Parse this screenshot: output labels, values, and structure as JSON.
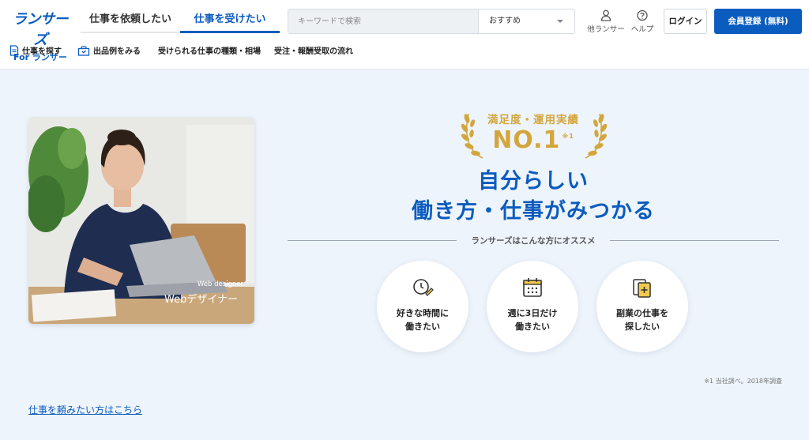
{
  "header": {
    "logo": {
      "main": "ランサーズ",
      "sub": "For ランサー"
    },
    "tabs": [
      {
        "label": "仕事を依頼したい",
        "active": false
      },
      {
        "label": "仕事を受けたい",
        "active": true
      }
    ],
    "search": {
      "placeholder": "キーワードで検索",
      "value": "",
      "sort_selected": "おすすめ"
    },
    "icons": {
      "other_lancers": {
        "label": "他ランサー",
        "icon": "person-icon"
      },
      "help": {
        "label": "ヘルプ",
        "icon": "question-circle-icon"
      }
    },
    "login_label": "ログイン",
    "register_label": "会員登録 (無料)"
  },
  "subnav": [
    {
      "label": "仕事を探す",
      "icon": "document-icon"
    },
    {
      "label": "出品例をみる",
      "icon": "shop-bag-icon"
    },
    {
      "label": "受けられる仕事の種類・相場",
      "icon": ""
    },
    {
      "label": "受注・報酬受取の流れ",
      "icon": ""
    }
  ],
  "hero": {
    "photo": {
      "caption_sub": "Web designer",
      "caption": "Webデザイナー"
    },
    "badge": {
      "top": "満足度・運用実績",
      "main": "NO.1",
      "mark": "※1"
    },
    "headline": [
      "自分らしい",
      "働き方・仕事がみつかる"
    ],
    "recommend_label": "ランサーズはこんな方にオススメ",
    "options": [
      {
        "label": "好きな時間に\n働きたい",
        "icon": "clock-pen-icon"
      },
      {
        "label": "週に3日だけ\n働きたい",
        "icon": "calendar-icon"
      },
      {
        "label": "副業の仕事を\n探したい",
        "icon": "documents-plus-icon"
      }
    ],
    "footnote": "※1 当社調べ。2018年調査"
  },
  "footer_link": "仕事を頼みたい方はこちら",
  "colors": {
    "brand": "#0b5cbf",
    "gold": "#d3a63d",
    "background": "#eef4fb"
  }
}
